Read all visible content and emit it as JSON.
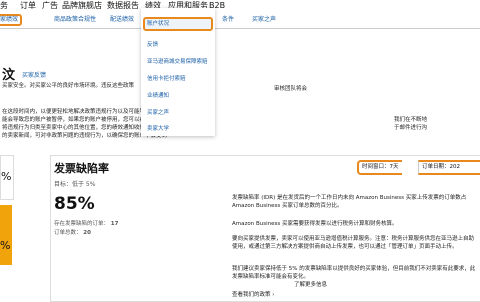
{
  "topnav": [
    "务",
    "订单",
    "广告",
    "品牌旗舰店",
    "数据报告",
    "绩效",
    "应用和服务",
    "B2B"
  ],
  "subnav": {
    "active": "家绩效",
    "tabs": [
      "商品政策合规性",
      "配送绩效",
      "绩效",
      "条件",
      "买家之声"
    ]
  },
  "menu": {
    "items": [
      "账户状况",
      "反馈",
      "亚马逊商城交易保障索赔",
      "信用卡拒付索赔",
      "业绩通知",
      "买家之声",
      "卖家大学"
    ]
  },
  "page": {
    "heading_fragment": "汶",
    "link_top": "买家反馈",
    "intro_lines": [
      "买家安全。对买家公平的良好市场环境。违反这些政策",
      "",
      "在这段时间内，以便更轻松地解决政策违规行为以及可能导致的",
      "能会导致您的账户被暂停，如果您的账户被停用，您可以在亚",
      "将违规行为归类至卖家中心的其他位置，您的绩效通知收件箱中",
      "的卖家新闻，可对非政策问题的违规行为，以确保您的账户不会受到"
    ],
    "right_fragments": [
      "审核团队将会",
      "我们在不断地",
      "于邮件进行沟"
    ],
    "defect_title": "发票缺陷率",
    "target": "目标：低于 5%",
    "big_percent": "85%",
    "sub1_label": "存在发票缺陷的订单：",
    "sub1_value": "17",
    "sub2_label": "订单总数：",
    "sub2_value": "20",
    "left_pct_1": "%",
    "left_pct_2": "%",
    "time_window": "时间窗口：7天",
    "order_date": "订单日期：202",
    "right_paras": [
      "发票缺陷率 (IDR) 是在发货后的一个工作日内未向 Amazon Business 买家上传发票的订单数占 Amazon Business 买家订单总数的百分比。",
      "Amazon Business 买家需要获得发票以进行税务计算和财务核算。",
      "要向买家提供发票，卖家可以使用亚马逊增值税计算服务。注意：税务计算服务供您在亚马逊上自助使用，或通过第三方解决方案提供商自动上传发票，也可以通过「管理订单」页面手动上传。",
      "我们建议卖家保持低于 5% 的发票缺陷率以提供良好的买家体验，但目前我们不对卖家有此要求，此发票缺陷率标准可能会有变化。"
    ],
    "learn_more": "了解更多信息",
    "policy_link": "查看我们的政策 ›"
  }
}
